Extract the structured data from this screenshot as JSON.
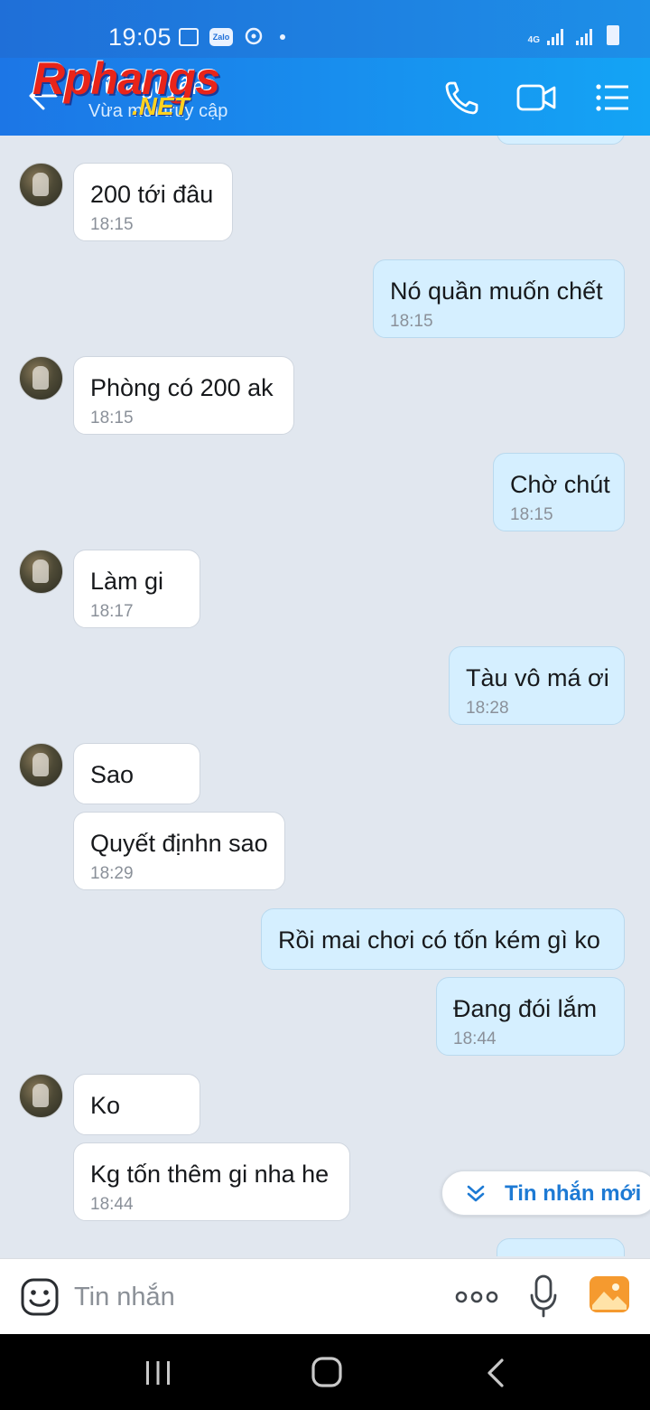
{
  "status_bar": {
    "time": "19:05",
    "zalo_label": "Zalo",
    "network": "4G"
  },
  "header": {
    "contact_name": "Vũ Nguyễn",
    "contact_status": "Vừa mới truy cập",
    "watermark": "Rphangs",
    "watermark_suffix": ".NET"
  },
  "messages": [
    {
      "dir": "in",
      "text": "200 tới đâu",
      "time": "18:15"
    },
    {
      "dir": "out",
      "text": "Nó quần muốn chết",
      "time": "18:15"
    },
    {
      "dir": "in",
      "text": "Phòng có 200 ak",
      "time": "18:15"
    },
    {
      "dir": "out",
      "text": "Chờ chút",
      "time": "18:15"
    },
    {
      "dir": "in",
      "text": "Làm gi",
      "time": "18:17"
    },
    {
      "dir": "out",
      "text": "Tàu vô má ơi",
      "time": "18:28"
    },
    {
      "dir": "in",
      "text": "Sao",
      "time": ""
    },
    {
      "dir": "in",
      "text": "Quyết địnhn sao",
      "time": "18:29"
    },
    {
      "dir": "out",
      "text": "Rồi mai chơi có tốn kém gì ko",
      "time": ""
    },
    {
      "dir": "out",
      "text": "Đang đói lắm",
      "time": "18:44"
    },
    {
      "dir": "in",
      "text": "Ko",
      "time": ""
    },
    {
      "dir": "in",
      "text": "Kg tốn thêm gi nha he",
      "time": "18:44"
    }
  ],
  "new_message_pill": {
    "label": "Tin nhắn mới"
  },
  "input": {
    "placeholder": "Tin nhắn"
  },
  "colors": {
    "header_start": "#1c76e6",
    "header_end": "#14a4f5",
    "chat_bg": "#e1e7ef",
    "bubble_in": "#ffffff",
    "bubble_out": "#d5efff",
    "accent": "#1d7ad4"
  },
  "icons": {
    "back": "back-arrow-icon",
    "call": "phone-icon",
    "video": "video-camera-icon",
    "menu": "list-menu-icon",
    "emoji": "emoji-icon",
    "more": "more-dots-icon",
    "mic": "microphone-icon",
    "image": "image-icon"
  }
}
